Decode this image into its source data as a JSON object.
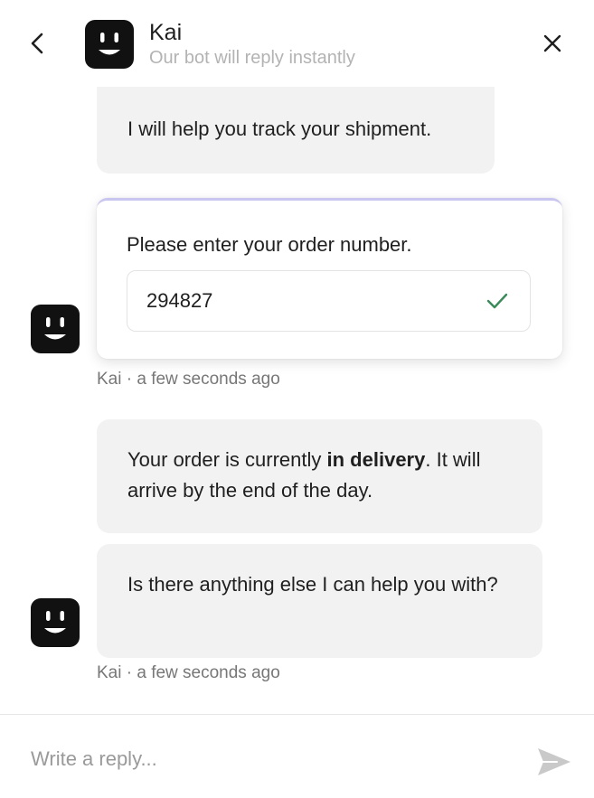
{
  "header": {
    "bot_name": "Kai",
    "subtitle": "Our bot will reply instantly",
    "back_icon": "chevron-left-icon",
    "close_icon": "close-icon",
    "avatar_icon": "bot-face-icon"
  },
  "messages": [
    {
      "text": "I will help you track your shipment."
    },
    {
      "prompt": "Please enter your order number.",
      "order_number": "294827",
      "status_icon": "check-icon"
    }
  ],
  "meta_1": "Kai · a few seconds ago",
  "message_3": {
    "before": "Your order is currently ",
    "bold": "in delivery",
    "after": ". It will arrive by the end of the day."
  },
  "message_4": {
    "text": "Is there anything else I can help you with?"
  },
  "meta_2": "Kai · a few seconds ago",
  "reply": {
    "placeholder": "Write a reply...",
    "send_icon": "send-icon"
  },
  "colors": {
    "avatar": "#111111",
    "bubble": "#f2f2f2",
    "check": "#3a8a5a",
    "card_accent": "#c8c5f0",
    "send": "#c9c9c9"
  }
}
